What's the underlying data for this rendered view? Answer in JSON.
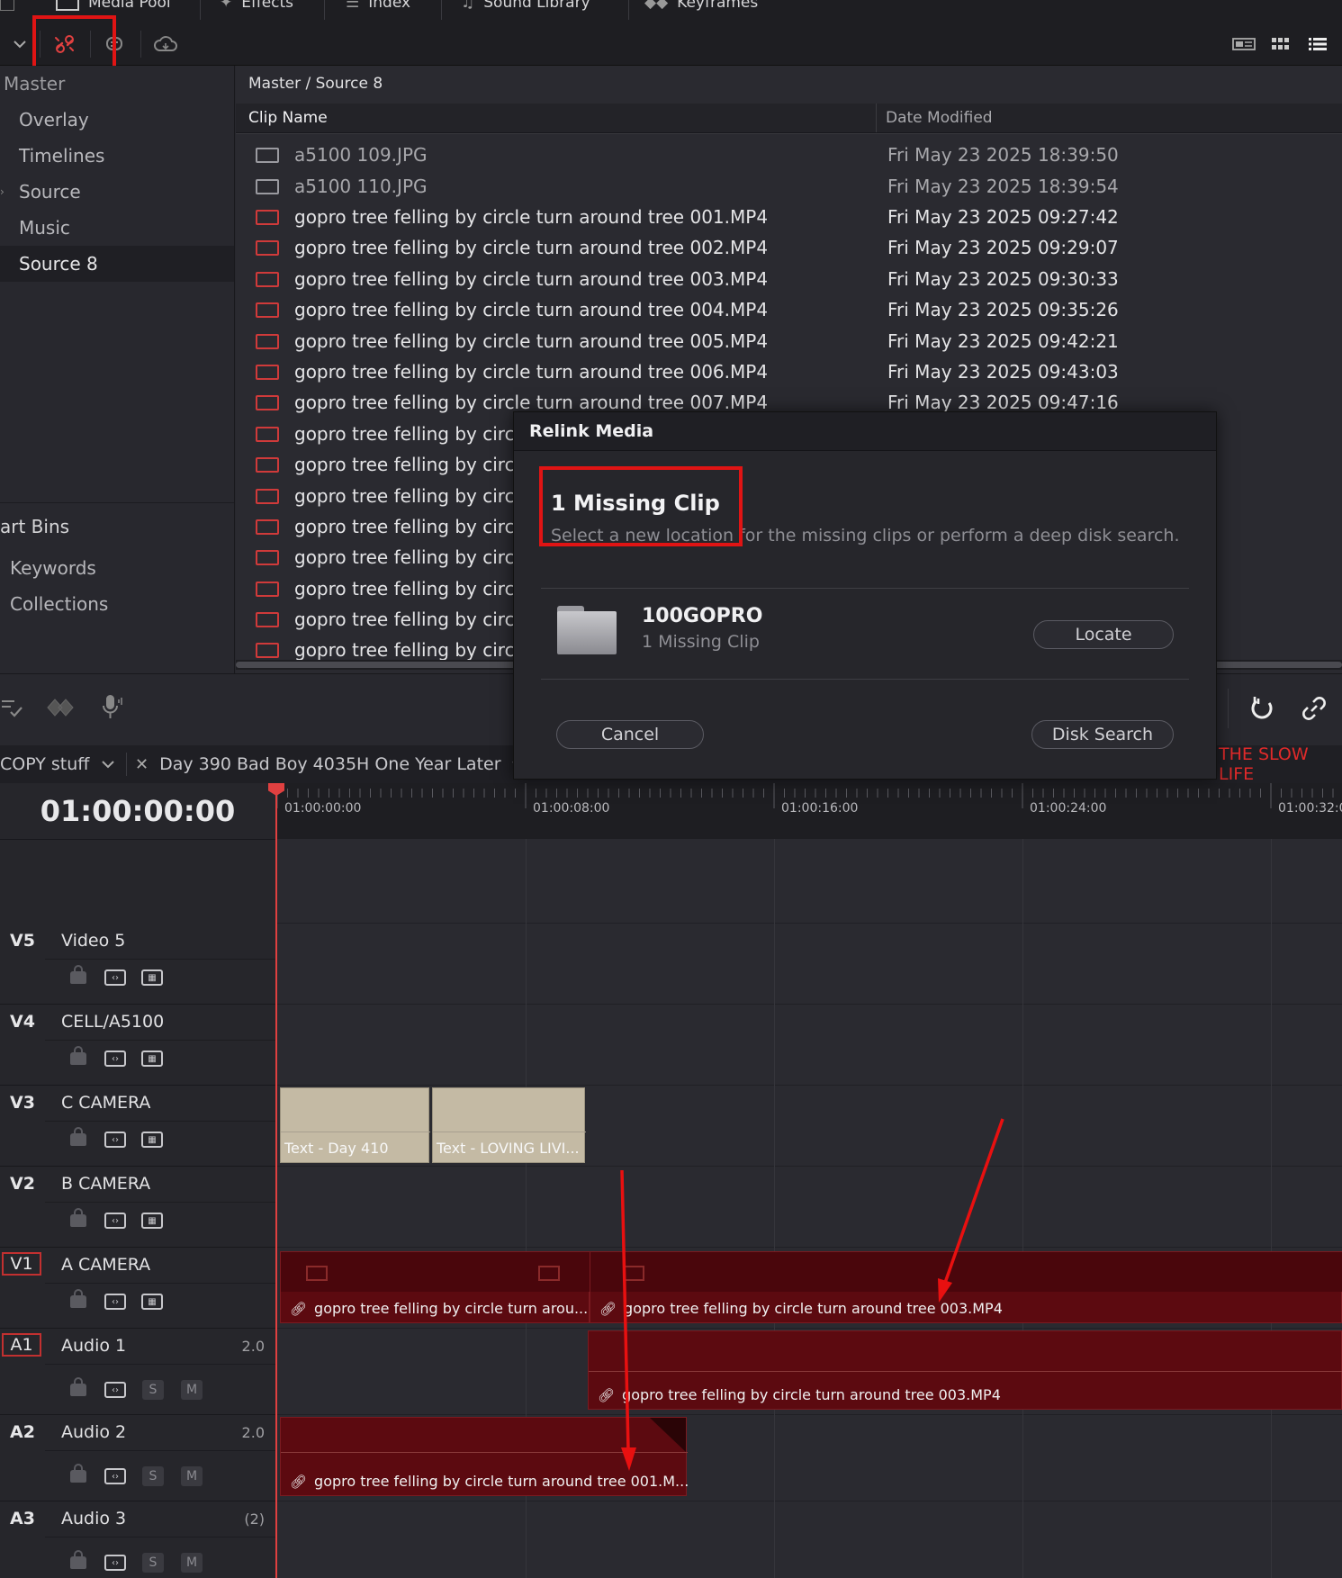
{
  "tabs": {
    "media_pool": "Media Pool",
    "effects": "Effects",
    "index": "Index",
    "sound_library": "Sound Library",
    "keyframes": "Keyframes"
  },
  "bins": {
    "master": "Master",
    "items": [
      "Overlay",
      "Timelines",
      "Source",
      "Music",
      "Source 8"
    ],
    "smart_bins_header": "art Bins",
    "smart_items": [
      "Keywords",
      "Collections"
    ]
  },
  "media": {
    "breadcrumb": "Master / Source 8",
    "col_clip_name": "Clip Name",
    "col_date_modified": "Date Modified",
    "rows": [
      {
        "name": "a5100  109.JPG",
        "date": "Fri May 23 2025 18:39:50"
      },
      {
        "name": "a5100  110.JPG",
        "date": "Fri May 23 2025 18:39:54"
      },
      {
        "name": "gopro tree felling by circle turn around tree 001.MP4",
        "date": "Fri May 23 2025 09:27:42"
      },
      {
        "name": "gopro tree felling by circle turn around tree 002.MP4",
        "date": "Fri May 23 2025 09:29:07"
      },
      {
        "name": "gopro tree felling by circle turn around tree 003.MP4",
        "date": "Fri May 23 2025 09:30:33"
      },
      {
        "name": "gopro tree felling by circle turn around tree 004.MP4",
        "date": "Fri May 23 2025 09:35:26"
      },
      {
        "name": "gopro tree felling by circle turn around tree 005.MP4",
        "date": "Fri May 23 2025 09:42:21"
      },
      {
        "name": "gopro tree felling by circle turn around tree 006.MP4",
        "date": "Fri May 23 2025 09:43:03"
      },
      {
        "name": "gopro tree felling by circle turn around tree 007.MP4",
        "date": "Fri May 23 2025 09:47:16"
      },
      {
        "name": "gopro tree felling by circle t",
        "date": ""
      },
      {
        "name": "gopro tree felling by circle t",
        "date": ""
      },
      {
        "name": "gopro tree felling by circle t",
        "date": ""
      },
      {
        "name": "gopro tree felling by circle t",
        "date": ""
      },
      {
        "name": "gopro tree felling by circle t",
        "date": ""
      },
      {
        "name": "gopro tree felling by circle t",
        "date": ""
      },
      {
        "name": "gopro tree felling by circle t",
        "date": ""
      },
      {
        "name": "gopro tree felling by circle t",
        "date": ""
      }
    ]
  },
  "dialog": {
    "title": "Relink Media",
    "heading": "1 Missing Clip",
    "subtext": "Select a new location for the missing clips or perform a deep disk search.",
    "folder_name": "100GOPRO",
    "folder_sub": "1 Missing Clip",
    "locate_label": "Locate",
    "cancel_label": "Cancel",
    "disk_search_label": "Disk Search"
  },
  "timeline": {
    "folder_tab": "COPY stuff",
    "timeline_tab": "Day 390 Bad Boy 4035H One Year Later",
    "right_tab": "THE SLOW LIFE",
    "timecode": "01:00:00:00",
    "ruler_labels": [
      "01:00:00:00",
      "01:00:08:00",
      "01:00:16:00",
      "01:00:24:00",
      "01:00:32:0"
    ],
    "tracks": [
      {
        "id": "V5",
        "name": "Video 5",
        "value": ""
      },
      {
        "id": "V4",
        "name": "CELL/A5100",
        "value": ""
      },
      {
        "id": "V3",
        "name": "C CAMERA",
        "value": ""
      },
      {
        "id": "V2",
        "name": "B CAMERA",
        "value": ""
      },
      {
        "id": "V1",
        "name": "A CAMERA",
        "value": ""
      },
      {
        "id": "A1",
        "name": "Audio 1",
        "value": "2.0"
      },
      {
        "id": "A2",
        "name": "Audio 2",
        "value": "2.0"
      },
      {
        "id": "A3",
        "name": "Audio 3",
        "value": "(2)"
      }
    ],
    "solo_label": "S",
    "mute_label": "M",
    "clips": {
      "v3_text_1": "Text - Day 410",
      "v3_text_2": "Text - LOVING LIVI...",
      "v1_clip_1": "gopro tree felling by circle turn arou...",
      "v1_clip_2": "gopro tree felling by circle turn around tree 003.MP4",
      "a1_clip": "gopro tree felling by circle turn around tree 003.MP4",
      "a2_clip": "gopro tree felling by circle turn around tree 001.M..."
    }
  },
  "colors": {
    "accent_red": "#e01414",
    "clip_red": "#5c0a10",
    "text_clip": "#c4baa4",
    "playhead": "#e04040"
  }
}
